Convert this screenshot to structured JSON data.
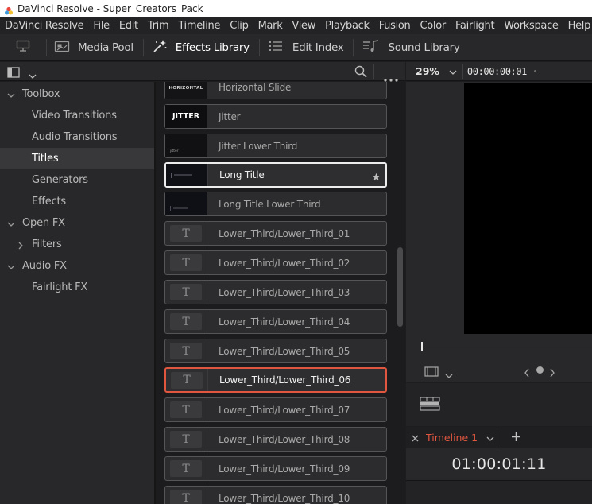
{
  "window": {
    "title": "DaVinci Resolve - Super_Creators_Pack"
  },
  "menu": [
    "DaVinci Resolve",
    "File",
    "Edit",
    "Trim",
    "Timeline",
    "Clip",
    "Mark",
    "View",
    "Playback",
    "Fusion",
    "Color",
    "Fairlight",
    "Workspace",
    "Help"
  ],
  "toolbar": {
    "media_pool": "Media Pool",
    "effects_library": "Effects Library",
    "edit_index": "Edit Index",
    "sound_library": "Sound Library"
  },
  "sidebar": {
    "items": [
      {
        "label": "Toolbox"
      },
      {
        "label": "Video Transitions"
      },
      {
        "label": "Audio Transitions"
      },
      {
        "label": "Titles"
      },
      {
        "label": "Generators"
      },
      {
        "label": "Effects"
      },
      {
        "label": "Open FX"
      },
      {
        "label": "Filters"
      },
      {
        "label": "Audio FX"
      },
      {
        "label": "Fairlight FX"
      }
    ]
  },
  "titles_list": [
    {
      "label": "Horizontal Slide",
      "thumb_text": "HORIZONTAL"
    },
    {
      "label": "Jitter",
      "thumb_text": "JITTER"
    },
    {
      "label": "Jitter Lower Third",
      "thumb_text": "jitter"
    },
    {
      "label": "Long Title"
    },
    {
      "label": "Long Title Lower Third"
    },
    {
      "label": "Lower_Third/Lower_Third_01"
    },
    {
      "label": "Lower_Third/Lower_Third_02"
    },
    {
      "label": "Lower_Third/Lower_Third_03"
    },
    {
      "label": "Lower_Third/Lower_Third_04"
    },
    {
      "label": "Lower_Third/Lower_Third_05"
    },
    {
      "label": "Lower_Third/Lower_Third_06"
    },
    {
      "label": "Lower_Third/Lower_Third_07"
    },
    {
      "label": "Lower_Third/Lower_Third_08"
    },
    {
      "label": "Lower_Third/Lower_Third_09"
    },
    {
      "label": "Lower_Third/Lower_Third_10"
    }
  ],
  "thumb_glyph": "T",
  "viewer": {
    "zoom": "29%",
    "timecode": "00:00:00:01"
  },
  "timeline": {
    "tab_label": "Timeline 1",
    "timecode": "01:00:01:11"
  },
  "colors": {
    "accent_orange": "#e0563f",
    "selected_white": "#ececec"
  }
}
